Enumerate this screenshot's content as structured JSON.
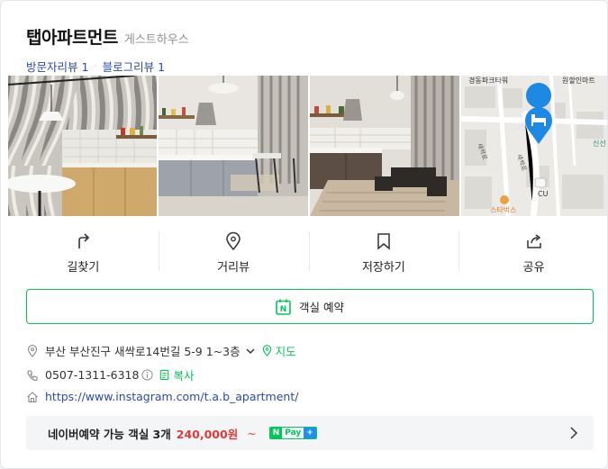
{
  "place": {
    "name": "탭아파트먼트",
    "category": "게스트하우스"
  },
  "reviews": {
    "visitor": "방문자리뷰 1",
    "blog": "블로그리뷰 1"
  },
  "map": {
    "label_building": "경동파크타워",
    "label_mart": "원할인마트",
    "label_road1": "새싹로",
    "label_road2": "새싹로",
    "label_shinsan": "신선",
    "label_store": "CU",
    "label_cafe": "스타벅스"
  },
  "actions": [
    {
      "label": "길찾기",
      "icon": "directions-icon"
    },
    {
      "label": "거리뷰",
      "icon": "location-pin-icon"
    },
    {
      "label": "저장하기",
      "icon": "bookmark-icon"
    },
    {
      "label": "공유",
      "icon": "share-icon"
    }
  ],
  "reserve": {
    "badge": "N",
    "label": "객실 예약"
  },
  "address": {
    "text": "부산 부산진구 새싹로14번길 5-9 1~3층",
    "map_link": "지도"
  },
  "phone": {
    "number": "0507-1311-6318",
    "copy_label": "복사"
  },
  "website": {
    "url": "https://www.instagram.com/t.a.b_apartment/"
  },
  "booking": {
    "text": "네이버예약 가능 객실 3개",
    "price": "240,000원",
    "tilde": "~",
    "npay_n": "N",
    "npay_pay": "Pay",
    "npay_plus": "+"
  },
  "colors": {
    "naver_green": "#03c75a",
    "link_blue": "#2a4aa8",
    "price_red": "#e23a3a"
  }
}
